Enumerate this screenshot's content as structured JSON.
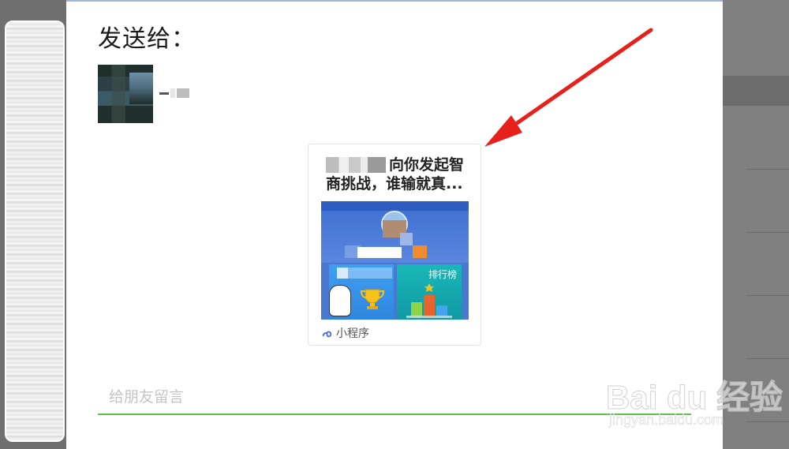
{
  "dialog": {
    "title": "发送给："
  },
  "mini_program_card": {
    "title": "向你发起智商挑战，谁输就真...",
    "tile_right_label": "排行榜",
    "footer_label": "小程序",
    "footer_icon": "mini-program-icon"
  },
  "message": {
    "placeholder": "给朋友留言",
    "value": ""
  },
  "watermark": {
    "main": "Bai du 经验",
    "sub": "jingyan.baidu.com"
  },
  "colors": {
    "input_underline": "#5fbf4f",
    "annotation_arrow": "#e8201b"
  }
}
